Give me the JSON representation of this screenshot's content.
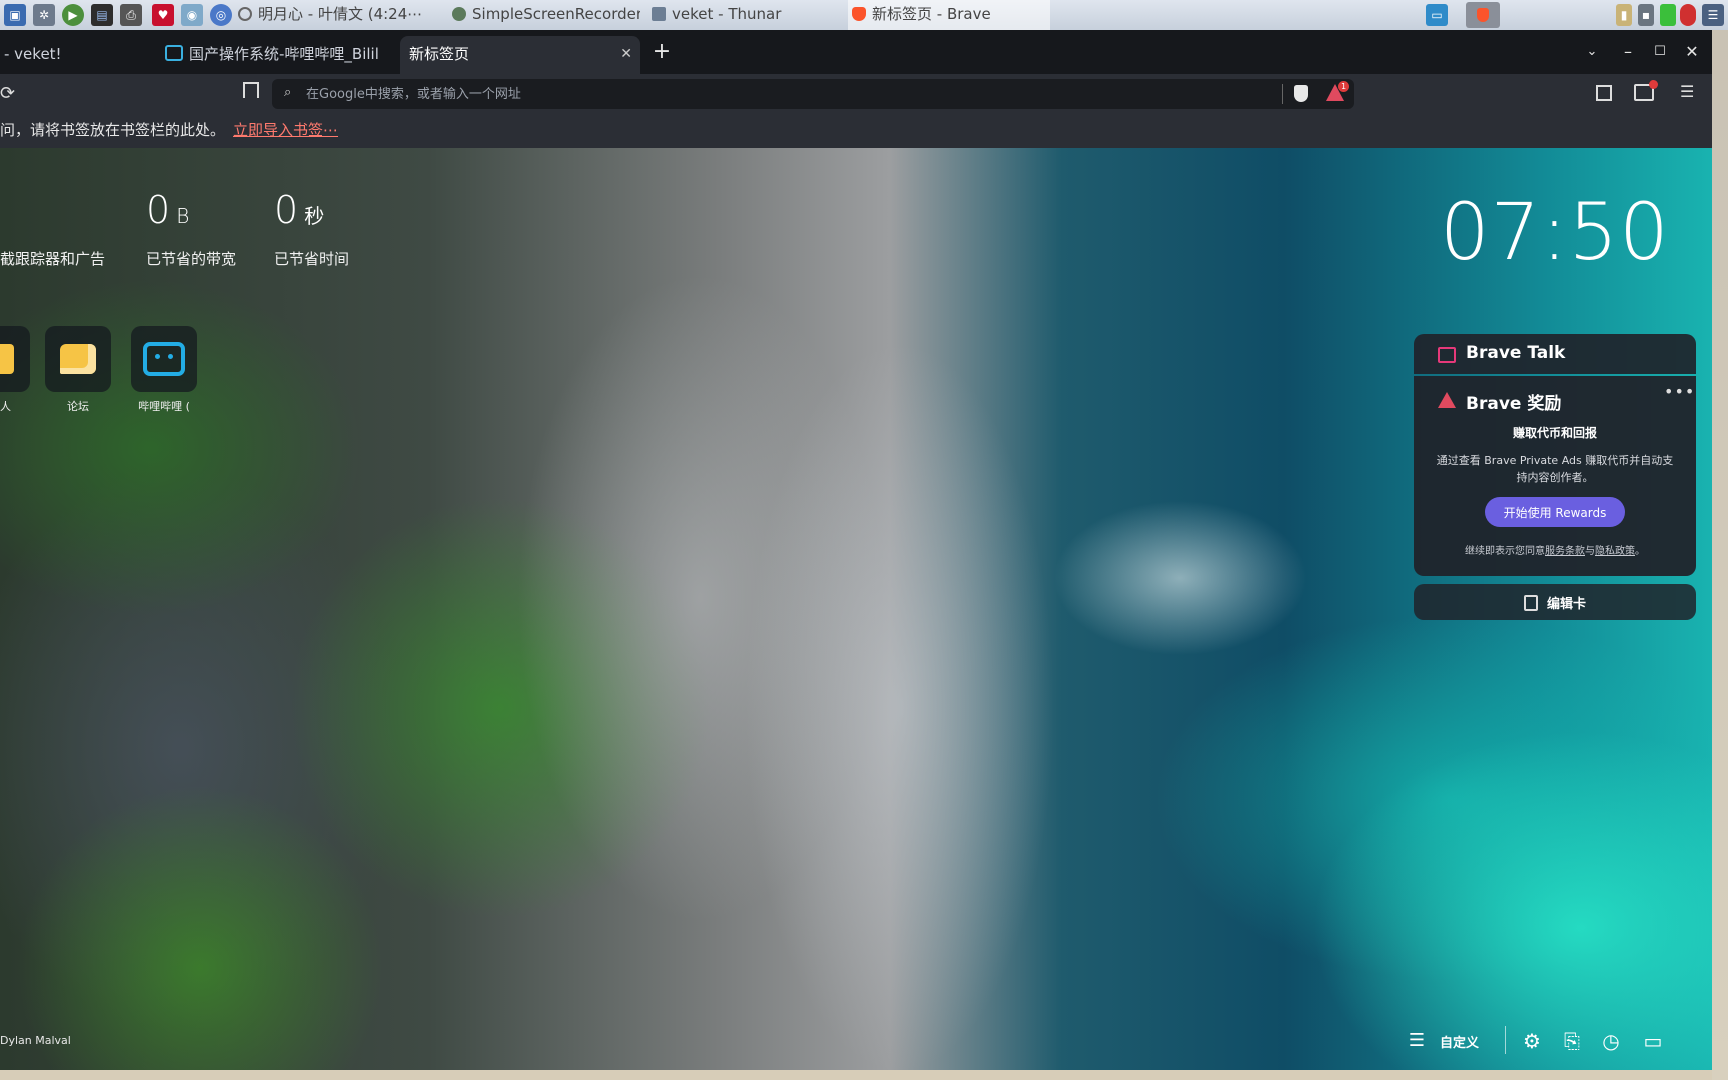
{
  "taskbar": {
    "tasks": [
      {
        "label": "明月心 - 叶倩文 (4:24⋯"
      },
      {
        "label": "SimpleScreenRecorder"
      },
      {
        "label": "veket - Thunar"
      },
      {
        "label": "新标签页 - Brave"
      }
    ]
  },
  "browser": {
    "tabs": [
      {
        "label": "- veket!"
      },
      {
        "label": "国产操作系统-哔哩哔哩_Bilil"
      },
      {
        "label": "新标签页"
      }
    ],
    "address_placeholder": "在Google中搜索，或者输入一个网址",
    "bookmarks_notice": "问，请将书签放在书签栏的此处。",
    "import_link": "立即导入书签⋯",
    "notification_count": "1"
  },
  "ntp": {
    "stats": [
      {
        "value": "0",
        "unit": "B",
        "label": "已节省的带宽"
      },
      {
        "value": "0",
        "unit": "秒",
        "label": "已节省时间"
      }
    ],
    "stat_blocked_label": "截跟踪器和广告",
    "clock": "07:50",
    "top_sites": [
      {
        "label": "人",
        "icon": "folder-icon"
      },
      {
        "label": "论坛",
        "icon": "chat-icon"
      },
      {
        "label": "哔哩哔哩 (",
        "icon": "bilibili-icon"
      }
    ],
    "photo_credit": "Dylan Malval",
    "customize_label": "自定义"
  },
  "widgets": {
    "talk_title": "Brave Talk",
    "rewards_title": "Brave 奖励",
    "rewards_subtitle": "赚取代币和回报",
    "rewards_desc": "通过查看 Brave Private Ads 赚取代币并自动支持内容创作者。",
    "rewards_button": "开始使用 Rewards",
    "rewards_terms_prefix": "继续即表示您同意",
    "rewards_terms_link": "服务条款",
    "rewards_terms_and": "与",
    "rewards_privacy_link": "隐私政策",
    "rewards_terms_suffix": "。",
    "edit_cards": "编辑卡"
  },
  "colors": {
    "accent": "#6a5fe0",
    "brave_orange": "#fb542b",
    "link": "#ff7a6e"
  }
}
